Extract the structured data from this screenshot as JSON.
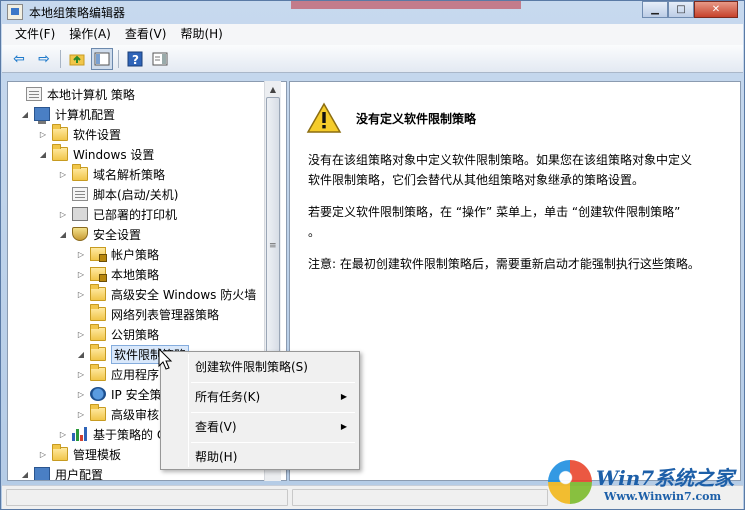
{
  "window": {
    "title": "本地组策略编辑器"
  },
  "menubar": {
    "items": [
      "文件(F)",
      "操作(A)",
      "查看(V)",
      "帮助(H)"
    ]
  },
  "tree": {
    "items": [
      {
        "label": "本地计算机 策略",
        "icon": "doc-icon",
        "twisty": "",
        "selected": false
      },
      {
        "label": "计算机配置",
        "icon": "computer-icon",
        "twisty": "◢",
        "selected": false
      },
      {
        "label": "软件设置",
        "icon": "folder-icon",
        "twisty": "▷",
        "selected": false
      },
      {
        "label": "Windows 设置",
        "icon": "folder-icon",
        "twisty": "◢",
        "selected": false
      },
      {
        "label": "域名解析策略",
        "icon": "folder-icon",
        "twisty": "▷",
        "selected": false
      },
      {
        "label": "脚本(启动/关机)",
        "icon": "script-icon",
        "twisty": "",
        "selected": false
      },
      {
        "label": "已部署的打印机",
        "icon": "printer-icon",
        "twisty": "▷",
        "selected": false
      },
      {
        "label": "安全设置",
        "icon": "security-icon",
        "twisty": "◢",
        "selected": false
      },
      {
        "label": "帐户策略",
        "icon": "lock-folder-icon",
        "twisty": "▷",
        "selected": false
      },
      {
        "label": "本地策略",
        "icon": "lock-folder-icon",
        "twisty": "▷",
        "selected": false
      },
      {
        "label": "高级安全 Windows 防火墙",
        "icon": "folder-icon",
        "twisty": "▷",
        "selected": false
      },
      {
        "label": "网络列表管理器策略",
        "icon": "folder-icon",
        "twisty": "",
        "selected": false
      },
      {
        "label": "公钥策略",
        "icon": "folder-icon",
        "twisty": "▷",
        "selected": false
      },
      {
        "label": "软件限制策略",
        "icon": "folder-icon",
        "twisty": "◢",
        "selected": true
      },
      {
        "label": "应用程序",
        "icon": "folder-icon",
        "twisty": "▷",
        "selected": false
      },
      {
        "label": "IP 安全策",
        "icon": "network-icon",
        "twisty": "▷",
        "selected": false
      },
      {
        "label": "高级审核",
        "icon": "folder-icon",
        "twisty": "▷",
        "selected": false
      },
      {
        "label": "基于策略的 Q",
        "icon": "chart-icon",
        "twisty": "▷",
        "selected": false
      },
      {
        "label": "管理模板",
        "icon": "folder-icon",
        "twisty": "▷",
        "selected": false
      },
      {
        "label": "用户配置",
        "icon": "user-icon",
        "twisty": "◢",
        "selected": false
      }
    ]
  },
  "detail": {
    "heading": "没有定义软件限制策略",
    "para1_line1": "没有在该组策略对象中定义软件限制策略。如果您在该组策略对象中定义",
    "para1_line2": "软件限制策略，它们会替代从其他组策略对象继承的策略设置。",
    "para2_line1": "若要定义软件限制策略，在 “操作” 菜单上，单击 “创建软件限制策略”",
    "para2_line2": "。",
    "para3": "注意: 在最初创建软件限制策略后，需要重新启动才能强制执行这些策略。"
  },
  "context_menu": {
    "create": "创建软件限制策略(S)",
    "all_tasks": "所有任务(K)",
    "view": "查看(V)",
    "help": "帮助(H)"
  },
  "watermark": {
    "brand": "Win7系统之家",
    "url": "Www.Winwin7.com"
  }
}
